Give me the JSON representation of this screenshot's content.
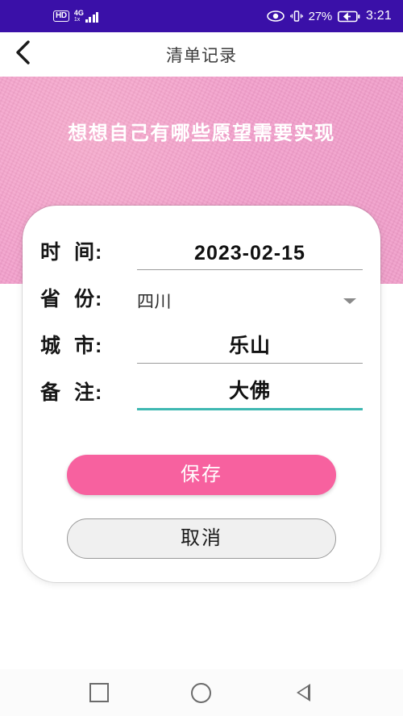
{
  "status_bar": {
    "hd_badge": "HD",
    "network_type": "4G",
    "network_sub": "1x",
    "signal_icon": "signal-bars-icon",
    "eye_icon": "eye-icon",
    "vibrate_icon": "vibrate-icon",
    "battery_percent": "27%",
    "battery_icon": "battery-charging-icon",
    "time": "3:21",
    "background_color": "#3A10A8"
  },
  "app_bar": {
    "back_icon": "chevron-left-icon",
    "title": "清单记录"
  },
  "banner": {
    "text": "想想自己有哪些愿望需要实现",
    "background_color": "#f29ecb",
    "text_color": "#ffffff"
  },
  "form": {
    "fields": [
      {
        "label_first": "时",
        "label_second": "间:",
        "value": "2023-02-15",
        "type": "underline",
        "focused": false
      },
      {
        "label_first": "省",
        "label_second": "份:",
        "value": "四川",
        "type": "select",
        "caret_icon": "chevron-down-icon",
        "focused": false
      },
      {
        "label_first": "城",
        "label_second": "市:",
        "value": "乐山",
        "type": "underline",
        "focused": false
      },
      {
        "label_first": "备",
        "label_second": "注:",
        "value": "大佛",
        "type": "underline",
        "focused": true
      }
    ],
    "save_label": "保存",
    "cancel_label": "取消",
    "save_color": "#f7619f",
    "cancel_color": "#f0f0f0",
    "focus_underline_color": "#3fb8b2"
  },
  "nav_bar": {
    "recents_icon": "square-recents-icon",
    "home_icon": "circle-home-icon",
    "back_icon": "triangle-back-icon"
  }
}
